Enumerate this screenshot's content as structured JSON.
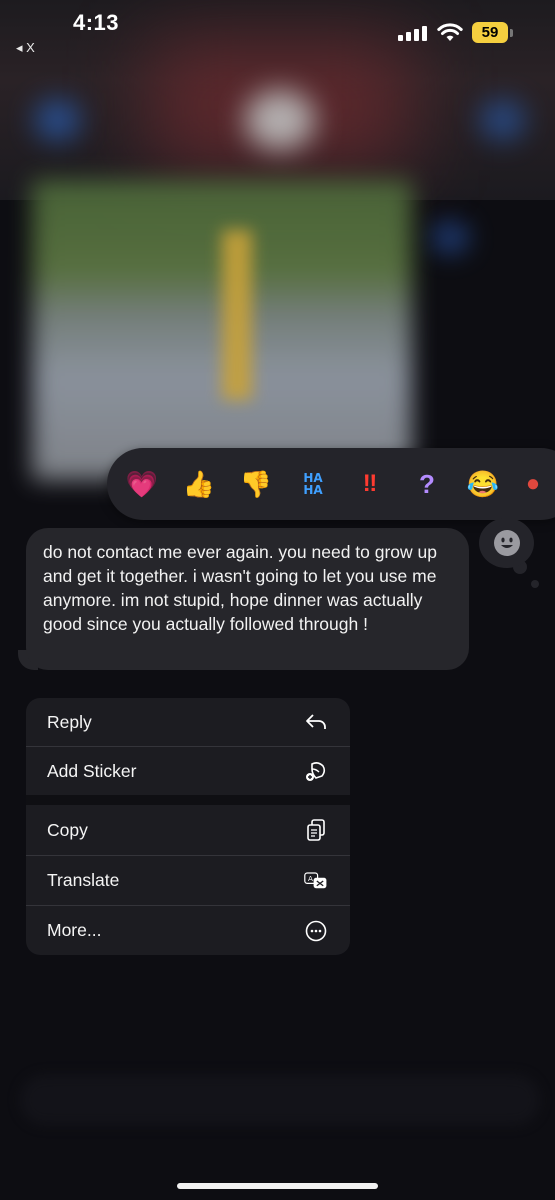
{
  "status_bar": {
    "time": "4:13",
    "back_label": "◂ X",
    "battery_level": "59"
  },
  "tapbacks": [
    {
      "name": "heart",
      "glyph": "💗"
    },
    {
      "name": "thumbs-up",
      "glyph": "👍"
    },
    {
      "name": "thumbs-down",
      "glyph": "👎"
    },
    {
      "name": "haha",
      "glyph": "HA HA"
    },
    {
      "name": "exclamation",
      "glyph": "‼"
    },
    {
      "name": "question",
      "glyph": "?"
    },
    {
      "name": "laughing",
      "glyph": "😂"
    }
  ],
  "message": {
    "text": "do not contact me ever again. you need to grow up and get it together. i wasn't going to let you use me anymore. im not stupid, hope dinner was actually good since you actually followed through !"
  },
  "menu": {
    "items": [
      {
        "label": "Reply",
        "icon": "reply-icon"
      },
      {
        "label": "Add Sticker",
        "icon": "sticker-icon"
      },
      {
        "label": "Copy",
        "icon": "copy-icon"
      },
      {
        "label": "Translate",
        "icon": "translate-icon"
      },
      {
        "label": "More...",
        "icon": "more-icon"
      }
    ]
  },
  "colors": {
    "battery": "#f5cf3f",
    "bubble": "#26262b",
    "menu_bg": "#1c1c21"
  }
}
